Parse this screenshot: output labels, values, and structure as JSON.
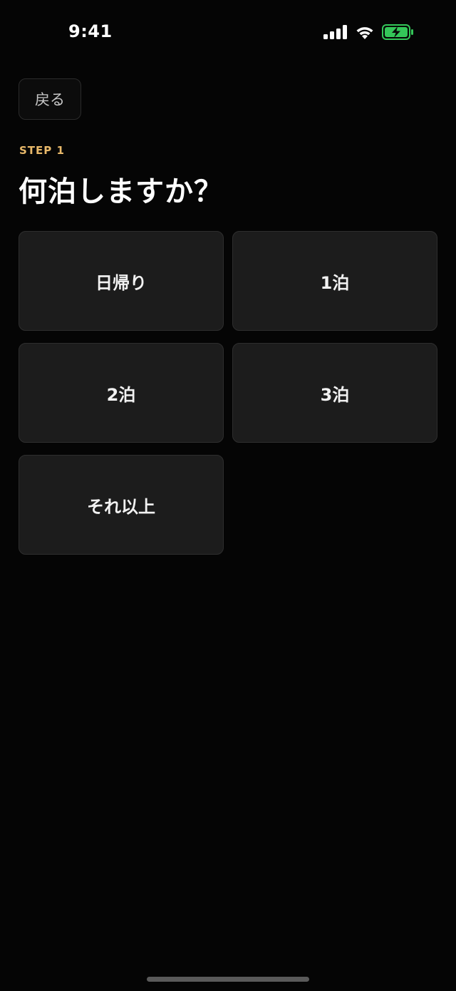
{
  "status_bar": {
    "time": "9:41",
    "icons": [
      "cellular-signal-icon",
      "wifi-icon",
      "battery-charging-icon"
    ],
    "battery_color": "#34c759"
  },
  "header": {
    "back_label": "戻る"
  },
  "step": {
    "label": "STEP 1",
    "label_color": "#e9b96a"
  },
  "question": {
    "title": "何泊しますか？"
  },
  "options": [
    {
      "label": "日帰り"
    },
    {
      "label": "1泊"
    },
    {
      "label": "2泊"
    },
    {
      "label": "3泊"
    },
    {
      "label": "それ以上"
    }
  ]
}
